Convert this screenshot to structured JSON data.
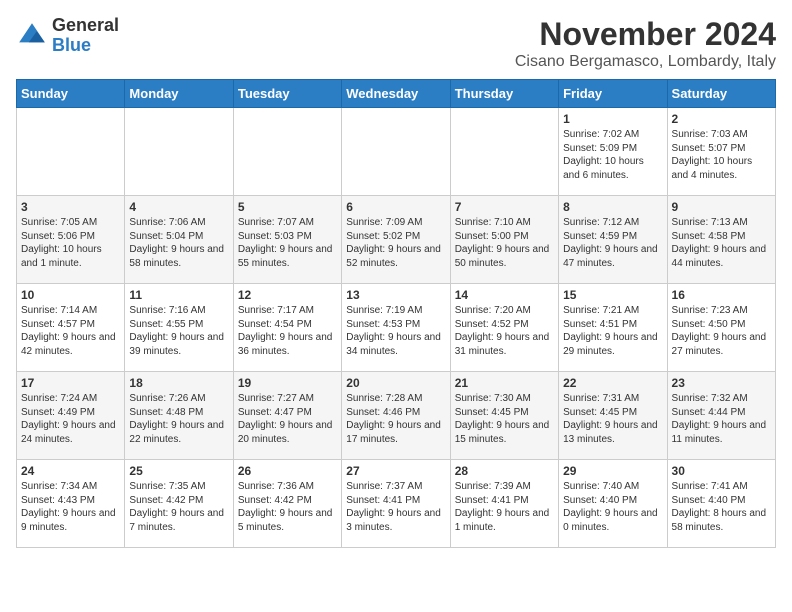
{
  "header": {
    "logo_general": "General",
    "logo_blue": "Blue",
    "title": "November 2024",
    "location": "Cisano Bergamasco, Lombardy, Italy"
  },
  "days_of_week": [
    "Sunday",
    "Monday",
    "Tuesday",
    "Wednesday",
    "Thursday",
    "Friday",
    "Saturday"
  ],
  "weeks": [
    [
      {
        "day": "",
        "info": ""
      },
      {
        "day": "",
        "info": ""
      },
      {
        "day": "",
        "info": ""
      },
      {
        "day": "",
        "info": ""
      },
      {
        "day": "",
        "info": ""
      },
      {
        "day": "1",
        "info": "Sunrise: 7:02 AM\nSunset: 5:09 PM\nDaylight: 10 hours and 6 minutes."
      },
      {
        "day": "2",
        "info": "Sunrise: 7:03 AM\nSunset: 5:07 PM\nDaylight: 10 hours and 4 minutes."
      }
    ],
    [
      {
        "day": "3",
        "info": "Sunrise: 7:05 AM\nSunset: 5:06 PM\nDaylight: 10 hours and 1 minute."
      },
      {
        "day": "4",
        "info": "Sunrise: 7:06 AM\nSunset: 5:04 PM\nDaylight: 9 hours and 58 minutes."
      },
      {
        "day": "5",
        "info": "Sunrise: 7:07 AM\nSunset: 5:03 PM\nDaylight: 9 hours and 55 minutes."
      },
      {
        "day": "6",
        "info": "Sunrise: 7:09 AM\nSunset: 5:02 PM\nDaylight: 9 hours and 52 minutes."
      },
      {
        "day": "7",
        "info": "Sunrise: 7:10 AM\nSunset: 5:00 PM\nDaylight: 9 hours and 50 minutes."
      },
      {
        "day": "8",
        "info": "Sunrise: 7:12 AM\nSunset: 4:59 PM\nDaylight: 9 hours and 47 minutes."
      },
      {
        "day": "9",
        "info": "Sunrise: 7:13 AM\nSunset: 4:58 PM\nDaylight: 9 hours and 44 minutes."
      }
    ],
    [
      {
        "day": "10",
        "info": "Sunrise: 7:14 AM\nSunset: 4:57 PM\nDaylight: 9 hours and 42 minutes."
      },
      {
        "day": "11",
        "info": "Sunrise: 7:16 AM\nSunset: 4:55 PM\nDaylight: 9 hours and 39 minutes."
      },
      {
        "day": "12",
        "info": "Sunrise: 7:17 AM\nSunset: 4:54 PM\nDaylight: 9 hours and 36 minutes."
      },
      {
        "day": "13",
        "info": "Sunrise: 7:19 AM\nSunset: 4:53 PM\nDaylight: 9 hours and 34 minutes."
      },
      {
        "day": "14",
        "info": "Sunrise: 7:20 AM\nSunset: 4:52 PM\nDaylight: 9 hours and 31 minutes."
      },
      {
        "day": "15",
        "info": "Sunrise: 7:21 AM\nSunset: 4:51 PM\nDaylight: 9 hours and 29 minutes."
      },
      {
        "day": "16",
        "info": "Sunrise: 7:23 AM\nSunset: 4:50 PM\nDaylight: 9 hours and 27 minutes."
      }
    ],
    [
      {
        "day": "17",
        "info": "Sunrise: 7:24 AM\nSunset: 4:49 PM\nDaylight: 9 hours and 24 minutes."
      },
      {
        "day": "18",
        "info": "Sunrise: 7:26 AM\nSunset: 4:48 PM\nDaylight: 9 hours and 22 minutes."
      },
      {
        "day": "19",
        "info": "Sunrise: 7:27 AM\nSunset: 4:47 PM\nDaylight: 9 hours and 20 minutes."
      },
      {
        "day": "20",
        "info": "Sunrise: 7:28 AM\nSunset: 4:46 PM\nDaylight: 9 hours and 17 minutes."
      },
      {
        "day": "21",
        "info": "Sunrise: 7:30 AM\nSunset: 4:45 PM\nDaylight: 9 hours and 15 minutes."
      },
      {
        "day": "22",
        "info": "Sunrise: 7:31 AM\nSunset: 4:45 PM\nDaylight: 9 hours and 13 minutes."
      },
      {
        "day": "23",
        "info": "Sunrise: 7:32 AM\nSunset: 4:44 PM\nDaylight: 9 hours and 11 minutes."
      }
    ],
    [
      {
        "day": "24",
        "info": "Sunrise: 7:34 AM\nSunset: 4:43 PM\nDaylight: 9 hours and 9 minutes."
      },
      {
        "day": "25",
        "info": "Sunrise: 7:35 AM\nSunset: 4:42 PM\nDaylight: 9 hours and 7 minutes."
      },
      {
        "day": "26",
        "info": "Sunrise: 7:36 AM\nSunset: 4:42 PM\nDaylight: 9 hours and 5 minutes."
      },
      {
        "day": "27",
        "info": "Sunrise: 7:37 AM\nSunset: 4:41 PM\nDaylight: 9 hours and 3 minutes."
      },
      {
        "day": "28",
        "info": "Sunrise: 7:39 AM\nSunset: 4:41 PM\nDaylight: 9 hours and 1 minute."
      },
      {
        "day": "29",
        "info": "Sunrise: 7:40 AM\nSunset: 4:40 PM\nDaylight: 9 hours and 0 minutes."
      },
      {
        "day": "30",
        "info": "Sunrise: 7:41 AM\nSunset: 4:40 PM\nDaylight: 8 hours and 58 minutes."
      }
    ]
  ]
}
